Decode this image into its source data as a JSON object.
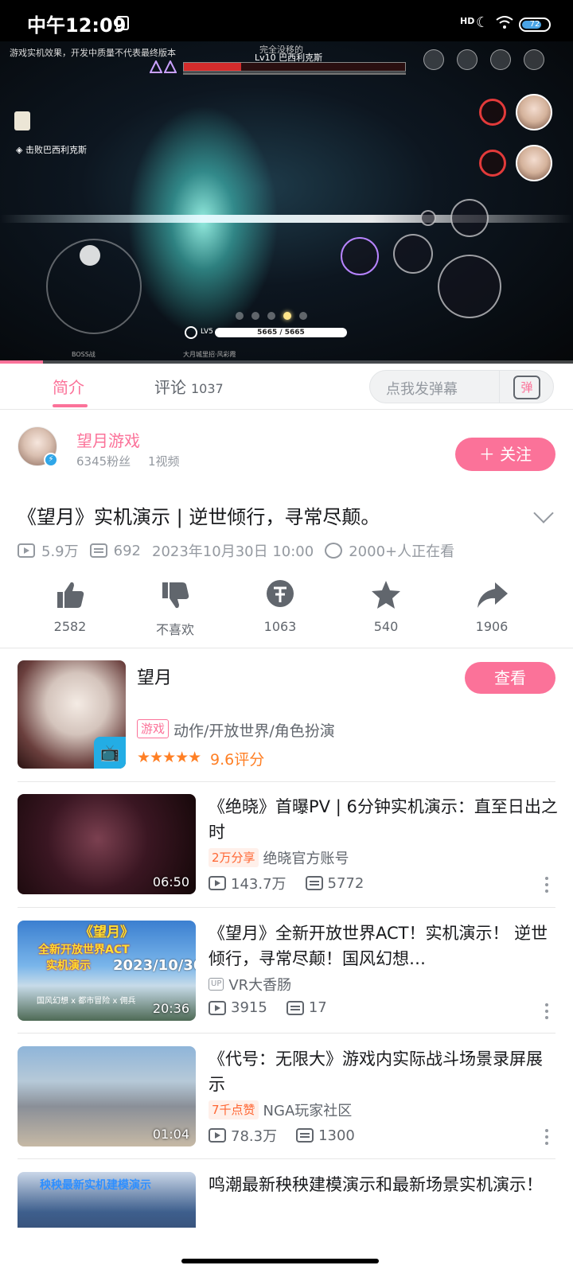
{
  "status_bar": {
    "time": "中午12:09",
    "network": "HD",
    "battery": "72"
  },
  "video_player": {
    "notice": "游戏实机效果，开发中质量不代表最终版本",
    "center_top_text": "完全没移的",
    "boss_name": "巴西利克斯",
    "boss_level": "Lv10",
    "quest_text": "击败巴西利克斯",
    "player_level": "LV5",
    "hp_text": "5665 / 5665",
    "bottom_label_1": "BOSS战",
    "bottom_label_2": "大月城里招·风彩霞",
    "progress": 0.075
  },
  "tabs": {
    "intro_label": "简介",
    "comments_label": "评论",
    "comments_count": "1037",
    "danmaku_placeholder": "点我发弹幕",
    "danmaku_icon_text": "弹"
  },
  "uploader": {
    "name": "望月游戏",
    "fans": "6345粉丝",
    "videos": "1视频",
    "follow_label": "＋ 关注"
  },
  "video": {
    "title": "《望月》实机演示 | 逆世倾行，寻常尽颠。",
    "views": "5.9万",
    "danmaku_count": "692",
    "publish_time": "2023年10月30日 10:00",
    "watching": "2000+人正在看"
  },
  "actions": {
    "like": "2582",
    "dislike": "不喜欢",
    "coin": "1063",
    "favorite": "540",
    "share": "1906"
  },
  "game_card": {
    "name": "望月",
    "view_label": "查看",
    "tag": "游戏",
    "genre": "动作/开放世界/角色扮演",
    "stars": "★★★★★",
    "rating": "9.6评分",
    "cover_badge": "📺"
  },
  "related": [
    {
      "title": "《绝晓》首曝PV | 6分钟实机演示：直至日出之时",
      "tag": "2万分享",
      "uploader": "绝晓官方账号",
      "views": "143.7万",
      "danmaku": "5772",
      "duration": "06:50"
    },
    {
      "title": "《望月》全新开放世界ACT！实机演示！ 逆世倾行，寻常尽颠！国风幻想…",
      "tag": "",
      "uploader": "VR大香肠",
      "views": "3915",
      "danmaku": "17",
      "duration": "20:36",
      "thumb_title": "《望月》",
      "thumb_sub": "全新开放世界ACT",
      "thumb_sub2": "实机演示",
      "thumb_date": "2023/10/30",
      "thumb_bottom": "国风幻想 x 都市冒险 x 佣兵"
    },
    {
      "title": "《代号：无限大》游戏内实际战斗场景录屏展示",
      "tag": "7千点赞",
      "uploader": "NGA玩家社区",
      "views": "78.3万",
      "danmaku": "1300",
      "duration": "01:04"
    },
    {
      "title": "鸣潮最新秧秧建模演示和最新场景实机演示！",
      "thumb_text": "秧秧最新实机建模演示"
    }
  ],
  "colors": {
    "accent": "#fb7299",
    "orange": "#ff7f24",
    "text": "#18191c",
    "sub_text": "#9499a0"
  }
}
